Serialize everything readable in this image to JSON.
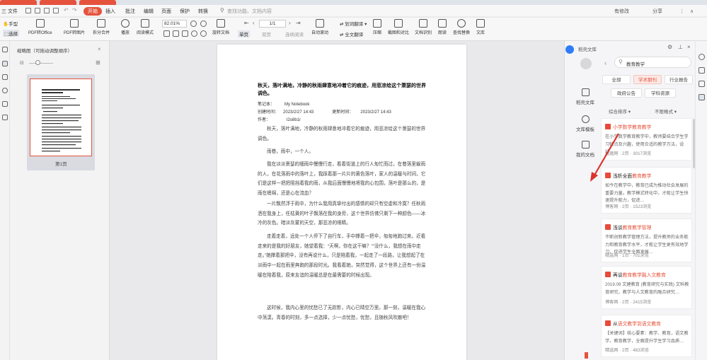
{
  "menubar": {
    "file": "三 文件",
    "items": [
      "开始",
      "插入",
      "批注",
      "编辑",
      "页面",
      "保护",
      "转换"
    ],
    "active": "开始",
    "search_placeholder": "查找功能、文档内容",
    "right": [
      "有修改",
      "分享"
    ]
  },
  "toolbar": {
    "hand": "手型",
    "select": "选择",
    "pdf_to_office": "PDF转Office",
    "pdf_to_image": "PDF转图片",
    "split_merge": "拆分合并",
    "play": "播放",
    "read_mode": "阅读模式",
    "zoom": "82.01%",
    "page_value": "1/1",
    "rotate_doc": "旋转文档",
    "single_page": "单页",
    "double_page": "双页",
    "continuous": "连续阅读",
    "auto_scroll": "自动滚动",
    "full_translate": "全文翻译",
    "compress": "压缩",
    "screenshot_compare": "截图和对比",
    "text_recog": "文档识别",
    "read_aloud": "朗读",
    "find_replace": "查找替换",
    "doc_library": "文库"
  },
  "thumbs": {
    "title": "缩略图（可拖动调整顺序）",
    "page_label": "第1页"
  },
  "doc": {
    "heading": "秋天，落叶满地，冷静的秋雨肆意地冲着它的痕迹，用悲凉给这个萧瑟的世界调色。",
    "meta": [
      {
        "k": "笔记本：",
        "v": "My Notebook"
      },
      {
        "k": "创建时间：",
        "v": "2023/2/27 14:43",
        "k2": "更新时间：",
        "v2": "2023/2/27 14:43"
      },
      {
        "k": "作者：",
        "v": "l2o8b1r"
      }
    ],
    "paragraphs": [
      "秋天，落叶满地，冷静的秋雨肆意地冲着它的痕迹，用悲凉给这个萧瑟的世界调色。",
      "雨巷，雨中，一个人。",
      "我在淡淡萧瑟的细雨中慢慢行走，看着街道上的行人匆忙而过，在巷落里躲雨的人，在花落雨中的落叶上，我踩着那一片片的黄色落叶，家人的温暖与时间，它们是这样一把把阻挡着我的雨，从我后面慢慢地将我的心包围，落叶是那么的，是雨在缠绵，还是心在流血？",
      "一片飘然浮于雨中，为什么我用真挚付出的感情的却只有空虚和冷寞？任秋雨洒在我身上，任枯黄的叶子飘落在我的身旁，这个世界仿佛只剩下一种颜色——冰冷的灰色。暗淡灰蒙的天空，那悲凉的眼睛。",
      "走着走着，远处一个人停下了自行车，手中撑着一把伞，匆匆地跑过来。近看走来的是我的好朋友，她望着我：“天啊，你在这干嘛？”“没什么，我想在雨中走走。”她撑着那把伞，没有再说什么，只是陪着我，一起走了一段路，让我想起了在淡雨中一起在雨里奔跑的那段时光。我看着她，突然觉得，这个世界上还有一份温暖在陪着我，原来友谊的温暖总是在最需要的时候出现。",
      "这时候，我内心里的忧愁已了无踪影，内心已晴空万里。那一刻，温暖在我心中荡漾。青春的时刻，多一点选择，少一点忧愁，忧愁，且随秋风吹散吧！"
    ]
  },
  "right": {
    "title": "稻壳文库",
    "search_value": "教育教学",
    "nav": [
      "稻壳文库",
      "文库模板",
      "我的文档"
    ],
    "chips": [
      "全部",
      "学术期刊",
      "行业报告",
      "政府公告",
      "学科资源"
    ],
    "filters": [
      "综合排序",
      "不限格式"
    ],
    "cards": [
      {
        "title_hl": "小学数学教育教学",
        "title_rest": "",
        "desc": "在小学数学教育教学中，教师要结合学生学习特点及兴趣，使用合适的教学方法，设计…",
        "meta": "精选网 · 2页 · 3017浏览"
      },
      {
        "title_hl": "浅析全面",
        "title_rest": "教育教学",
        "desc": "如今在教学中，教育已成为推动社会发展的重要力量。教学模式转化中，才能让学生快速提升能力，促进…",
        "meta": "博客网 · 2页 · 1523浏览"
      },
      {
        "title_hl": "浅谈",
        "title_rest": "教育教学管理",
        "desc": "不断创新教学管理方法，提升教师的业务能力和教育教学水平，才能让学生更有效地学习，促进学生全面发展…",
        "meta": "精选网 · 1页 · 701浏览"
      },
      {
        "title_hl": "再谈",
        "title_rest": "教育教学融入文教育",
        "desc": "2019.09 文建教育 (教育研究与实践) 文科教育研究，教学与人文教育的融合研究…",
        "meta": "博客网 · 2页 · 2415浏览"
      },
      {
        "title_hl": "从",
        "title_rest": "语文教学到语文教育",
        "desc": "【关键词】核心要素：教学、教育，语文教学，教育教学，全面提升学生学习品质…",
        "meta": "精选网 · 2页 · 483浏览"
      }
    ]
  },
  "colors": {
    "accent": "#e5533d",
    "arrow": "#d9342b"
  }
}
